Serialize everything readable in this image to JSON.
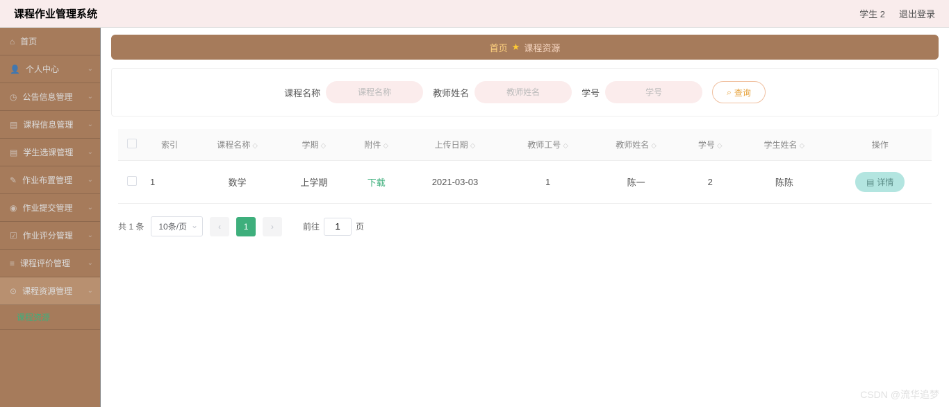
{
  "header": {
    "title": "课程作业管理系统",
    "user": "学生 2",
    "logout": "退出登录"
  },
  "sidebar": {
    "items": [
      {
        "icon": "home",
        "label": "首页",
        "hasChevron": false
      },
      {
        "icon": "user",
        "label": "个人中心",
        "hasChevron": true
      },
      {
        "icon": "bell",
        "label": "公告信息管理",
        "hasChevron": true
      },
      {
        "icon": "book",
        "label": "课程信息管理",
        "hasChevron": true
      },
      {
        "icon": "select",
        "label": "学生选课管理",
        "hasChevron": true
      },
      {
        "icon": "assign",
        "label": "作业布置管理",
        "hasChevron": true
      },
      {
        "icon": "submit",
        "label": "作业提交管理",
        "hasChevron": true
      },
      {
        "icon": "score",
        "label": "作业评分管理",
        "hasChevron": true
      },
      {
        "icon": "review",
        "label": "课程评价管理",
        "hasChevron": true
      },
      {
        "icon": "resource",
        "label": "课程资源管理",
        "hasChevron": true
      }
    ],
    "subitem": "课程资源"
  },
  "breadcrumb": {
    "home": "首页",
    "current": "课程资源"
  },
  "search": {
    "field1_label": "课程名称",
    "field1_placeholder": "课程名称",
    "field2_label": "教师姓名",
    "field2_placeholder": "教师姓名",
    "field3_label": "学号",
    "field3_placeholder": "学号",
    "button": "查询"
  },
  "table": {
    "headers": [
      "索引",
      "课程名称",
      "学期",
      "附件",
      "上传日期",
      "教师工号",
      "教师姓名",
      "学号",
      "学生姓名",
      "操作"
    ],
    "rows": [
      {
        "index": "1",
        "course": "数学",
        "term": "上学期",
        "attachment": "下载",
        "date": "2021-03-03",
        "tid": "1",
        "tname": "陈一",
        "sid": "2",
        "sname": "陈陈"
      }
    ],
    "detail_btn": "详情"
  },
  "pagination": {
    "total": "共 1 条",
    "pagesize": "10条/页",
    "page": "1",
    "goto_prefix": "前往",
    "goto_value": "1",
    "goto_suffix": "页"
  },
  "watermark": "CSDN @流华追梦"
}
